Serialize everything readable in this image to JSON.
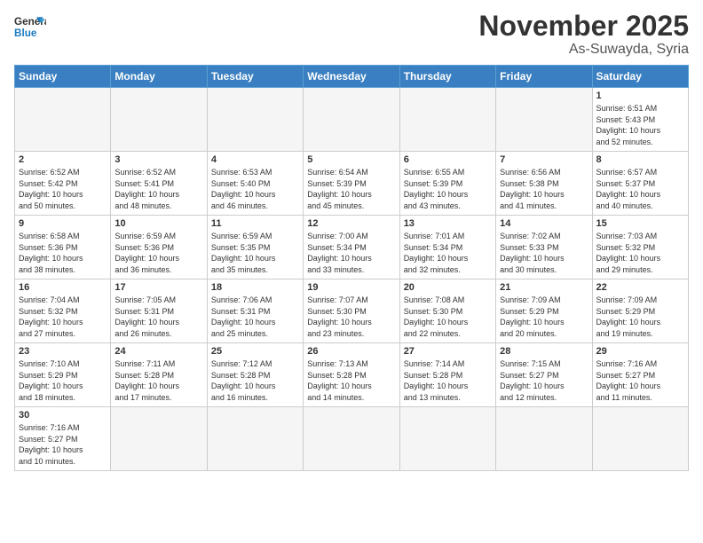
{
  "header": {
    "logo_general": "General",
    "logo_blue": "Blue",
    "month_title": "November 2025",
    "location": "As-Suwayda, Syria"
  },
  "weekdays": [
    "Sunday",
    "Monday",
    "Tuesday",
    "Wednesday",
    "Thursday",
    "Friday",
    "Saturday"
  ],
  "weeks": [
    [
      {
        "day": "",
        "info": ""
      },
      {
        "day": "",
        "info": ""
      },
      {
        "day": "",
        "info": ""
      },
      {
        "day": "",
        "info": ""
      },
      {
        "day": "",
        "info": ""
      },
      {
        "day": "",
        "info": ""
      },
      {
        "day": "1",
        "info": "Sunrise: 6:51 AM\nSunset: 5:43 PM\nDaylight: 10 hours\nand 52 minutes."
      }
    ],
    [
      {
        "day": "2",
        "info": "Sunrise: 6:52 AM\nSunset: 5:42 PM\nDaylight: 10 hours\nand 50 minutes."
      },
      {
        "day": "3",
        "info": "Sunrise: 6:52 AM\nSunset: 5:41 PM\nDaylight: 10 hours\nand 48 minutes."
      },
      {
        "day": "4",
        "info": "Sunrise: 6:53 AM\nSunset: 5:40 PM\nDaylight: 10 hours\nand 46 minutes."
      },
      {
        "day": "5",
        "info": "Sunrise: 6:54 AM\nSunset: 5:39 PM\nDaylight: 10 hours\nand 45 minutes."
      },
      {
        "day": "6",
        "info": "Sunrise: 6:55 AM\nSunset: 5:39 PM\nDaylight: 10 hours\nand 43 minutes."
      },
      {
        "day": "7",
        "info": "Sunrise: 6:56 AM\nSunset: 5:38 PM\nDaylight: 10 hours\nand 41 minutes."
      },
      {
        "day": "8",
        "info": "Sunrise: 6:57 AM\nSunset: 5:37 PM\nDaylight: 10 hours\nand 40 minutes."
      }
    ],
    [
      {
        "day": "9",
        "info": "Sunrise: 6:58 AM\nSunset: 5:36 PM\nDaylight: 10 hours\nand 38 minutes."
      },
      {
        "day": "10",
        "info": "Sunrise: 6:59 AM\nSunset: 5:36 PM\nDaylight: 10 hours\nand 36 minutes."
      },
      {
        "day": "11",
        "info": "Sunrise: 6:59 AM\nSunset: 5:35 PM\nDaylight: 10 hours\nand 35 minutes."
      },
      {
        "day": "12",
        "info": "Sunrise: 7:00 AM\nSunset: 5:34 PM\nDaylight: 10 hours\nand 33 minutes."
      },
      {
        "day": "13",
        "info": "Sunrise: 7:01 AM\nSunset: 5:34 PM\nDaylight: 10 hours\nand 32 minutes."
      },
      {
        "day": "14",
        "info": "Sunrise: 7:02 AM\nSunset: 5:33 PM\nDaylight: 10 hours\nand 30 minutes."
      },
      {
        "day": "15",
        "info": "Sunrise: 7:03 AM\nSunset: 5:32 PM\nDaylight: 10 hours\nand 29 minutes."
      }
    ],
    [
      {
        "day": "16",
        "info": "Sunrise: 7:04 AM\nSunset: 5:32 PM\nDaylight: 10 hours\nand 27 minutes."
      },
      {
        "day": "17",
        "info": "Sunrise: 7:05 AM\nSunset: 5:31 PM\nDaylight: 10 hours\nand 26 minutes."
      },
      {
        "day": "18",
        "info": "Sunrise: 7:06 AM\nSunset: 5:31 PM\nDaylight: 10 hours\nand 25 minutes."
      },
      {
        "day": "19",
        "info": "Sunrise: 7:07 AM\nSunset: 5:30 PM\nDaylight: 10 hours\nand 23 minutes."
      },
      {
        "day": "20",
        "info": "Sunrise: 7:08 AM\nSunset: 5:30 PM\nDaylight: 10 hours\nand 22 minutes."
      },
      {
        "day": "21",
        "info": "Sunrise: 7:09 AM\nSunset: 5:29 PM\nDaylight: 10 hours\nand 20 minutes."
      },
      {
        "day": "22",
        "info": "Sunrise: 7:09 AM\nSunset: 5:29 PM\nDaylight: 10 hours\nand 19 minutes."
      }
    ],
    [
      {
        "day": "23",
        "info": "Sunrise: 7:10 AM\nSunset: 5:29 PM\nDaylight: 10 hours\nand 18 minutes."
      },
      {
        "day": "24",
        "info": "Sunrise: 7:11 AM\nSunset: 5:28 PM\nDaylight: 10 hours\nand 17 minutes."
      },
      {
        "day": "25",
        "info": "Sunrise: 7:12 AM\nSunset: 5:28 PM\nDaylight: 10 hours\nand 16 minutes."
      },
      {
        "day": "26",
        "info": "Sunrise: 7:13 AM\nSunset: 5:28 PM\nDaylight: 10 hours\nand 14 minutes."
      },
      {
        "day": "27",
        "info": "Sunrise: 7:14 AM\nSunset: 5:28 PM\nDaylight: 10 hours\nand 13 minutes."
      },
      {
        "day": "28",
        "info": "Sunrise: 7:15 AM\nSunset: 5:27 PM\nDaylight: 10 hours\nand 12 minutes."
      },
      {
        "day": "29",
        "info": "Sunrise: 7:16 AM\nSunset: 5:27 PM\nDaylight: 10 hours\nand 11 minutes."
      }
    ],
    [
      {
        "day": "30",
        "info": "Sunrise: 7:16 AM\nSunset: 5:27 PM\nDaylight: 10 hours\nand 10 minutes."
      },
      {
        "day": "",
        "info": ""
      },
      {
        "day": "",
        "info": ""
      },
      {
        "day": "",
        "info": ""
      },
      {
        "day": "",
        "info": ""
      },
      {
        "day": "",
        "info": ""
      },
      {
        "day": "",
        "info": ""
      }
    ]
  ]
}
